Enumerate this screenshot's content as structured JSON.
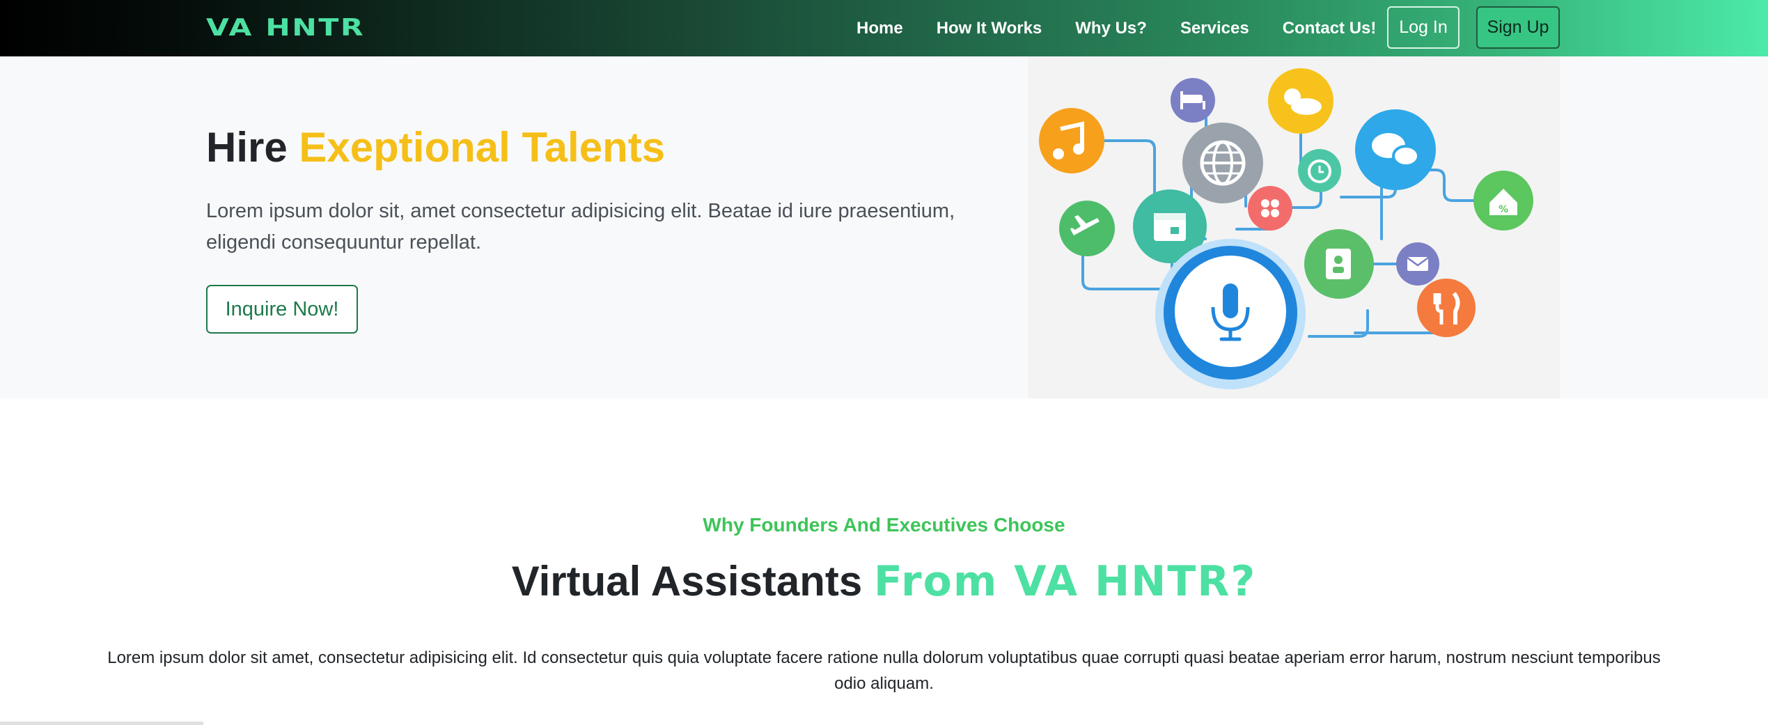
{
  "brand": {
    "name": "VA HNTR"
  },
  "nav": {
    "links": [
      "Home",
      "How It Works",
      "Why Us?",
      "Services",
      "Contact Us!"
    ],
    "login_label": "Log In",
    "signup_label": "Sign Up"
  },
  "hero": {
    "title_plain": "Hire ",
    "title_accent": "Exeptional Talents",
    "description": "Lorem ipsum dolor sit, amet consectetur adipisicing elit. Beatae id iure praesentium, eligendi consequuntur repellat.",
    "cta_label": "Inquire Now!"
  },
  "section": {
    "kicker": "Why Founders And Executives Choose",
    "title_plain": "Virtual Assistants ",
    "title_accent": "From VA HNTR?",
    "description": "Lorem ipsum dolor sit amet, consectetur adipisicing elit. Id consectetur quis quia voluptate facere ratione nulla dolorum voluptatibus quae corrupti quasi beatae aperiam error harum, nostrum nesciunt temporibus odio aliquam."
  },
  "illustration_icons": [
    "music-icon",
    "bed-icon",
    "weather-icon",
    "globe-icon",
    "chat-icon",
    "alarm-icon",
    "home-percent-icon",
    "plane-icon",
    "calendar-icon",
    "clover-icon",
    "contacts-icon",
    "mail-icon",
    "fork-knife-icon",
    "microphone-icon"
  ],
  "colors": {
    "brand_green": "#4de0a3",
    "accent_yellow": "#f5bf18",
    "kicker_green": "#3ec45a",
    "button_green": "#1d7a4a"
  }
}
